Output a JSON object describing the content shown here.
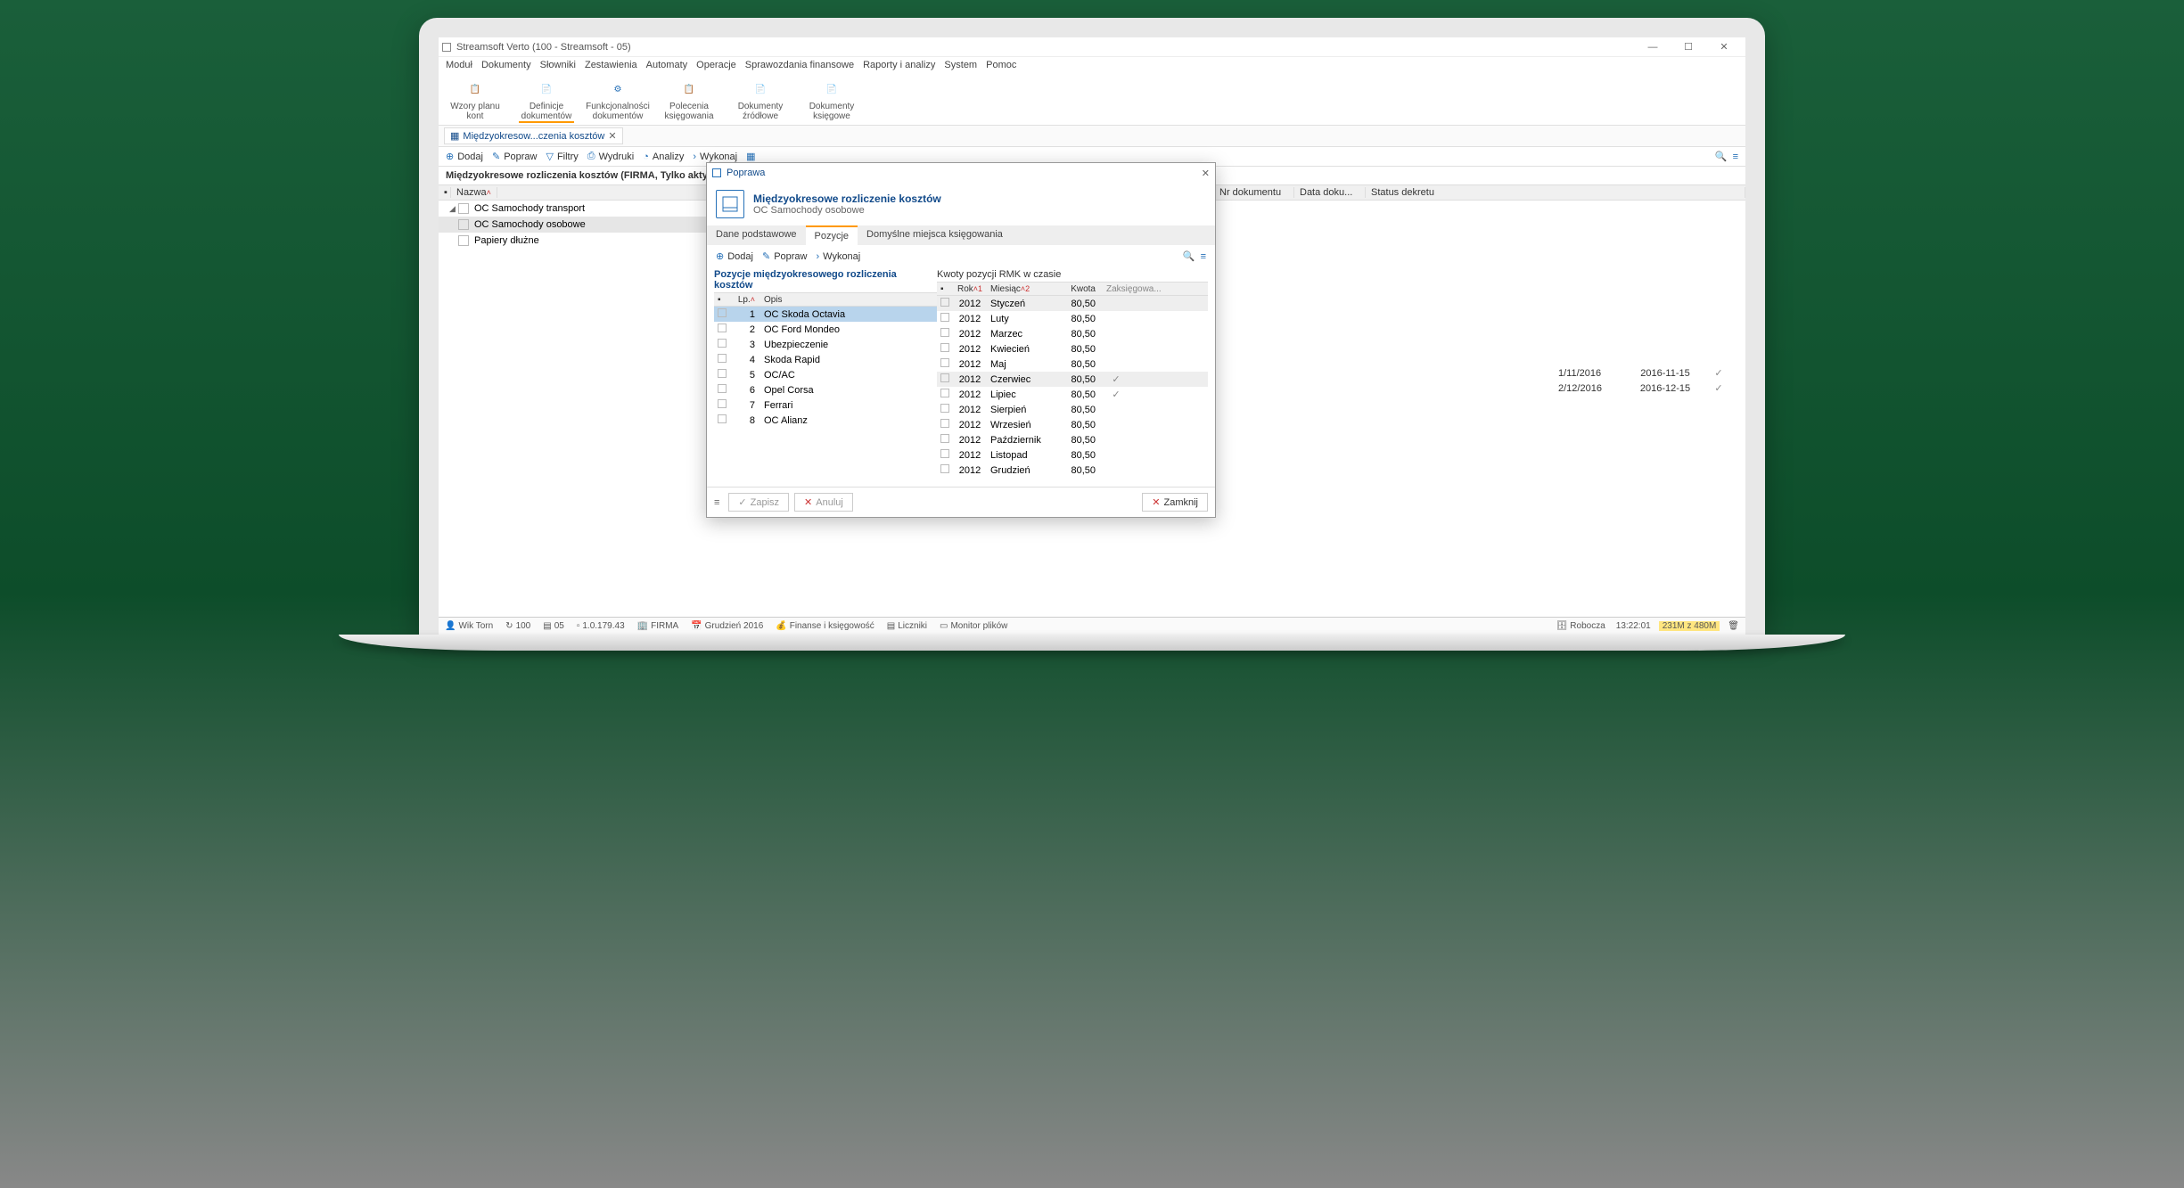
{
  "title": "Streamsoft Verto (100 - Streamsoft - 05)",
  "menu": [
    "Moduł",
    "Dokumenty",
    "Słowniki",
    "Zestawienia",
    "Automaty",
    "Operacje",
    "Sprawozdania finansowe",
    "Raporty i analizy",
    "System",
    "Pomoc"
  ],
  "ribbon": [
    {
      "l1": "Wzory planu",
      "l2": "kont"
    },
    {
      "l1": "Definicje",
      "l2": "dokumentów"
    },
    {
      "l1": "Funkcjonalności",
      "l2": "dokumentów"
    },
    {
      "l1": "Polecenia",
      "l2": "księgowania"
    },
    {
      "l1": "Dokumenty",
      "l2": "źródłowe"
    },
    {
      "l1": "Dokumenty",
      "l2": "księgowe"
    }
  ],
  "doc_tab": "Międzyokresow...czenia kosztów",
  "toolbar": [
    "Dodaj",
    "Popraw",
    "Filtry",
    "Wydruki",
    "Analizy",
    "Wykonaj"
  ],
  "section_title": "Międzyokresowe rozliczenia kosztów (FIRMA, Tylko aktywne)",
  "tree_header": "Nazwa",
  "tree": [
    {
      "label": "OC Samochody transport",
      "expanded": true
    },
    {
      "label": "OC Samochody osobowe",
      "selected": true
    },
    {
      "label": "Papiery dłużne"
    }
  ],
  "main_cols": [
    "Nr dokumentu",
    "Data doku...",
    "Status dekretu"
  ],
  "main_rows": [
    {
      "nr": "1/11/2016",
      "data": "2016-11-15"
    },
    {
      "nr": "2/12/2016",
      "data": "2016-12-15"
    }
  ],
  "dialog": {
    "title": "Poprawa",
    "header_title": "Międzyokresowe rozliczenie kosztów",
    "header_sub": "OC Samochody osobowe",
    "tabs": [
      "Dane podstawowe",
      "Pozycje",
      "Domyślne miejsca księgowania"
    ],
    "active_tab": 1,
    "tb": [
      "Dodaj",
      "Popraw",
      "Wykonaj"
    ],
    "left_title": "Pozycje międzyokresowego rozliczenia kosztów",
    "left_cols": {
      "lp": "Lp.",
      "opis": "Opis"
    },
    "left_rows": [
      {
        "lp": 1,
        "opis": "OC Skoda Octavia",
        "sel": true
      },
      {
        "lp": 2,
        "opis": "OC Ford Mondeo"
      },
      {
        "lp": 3,
        "opis": "Ubezpieczenie"
      },
      {
        "lp": 4,
        "opis": "Skoda Rapid"
      },
      {
        "lp": 5,
        "opis": "OC/AC"
      },
      {
        "lp": 6,
        "opis": "Opel Corsa"
      },
      {
        "lp": 7,
        "opis": "Ferrari"
      },
      {
        "lp": 8,
        "opis": "OC Alianz"
      }
    ],
    "right_title": "Kwoty pozycji RMK w czasie",
    "right_cols": {
      "rok": "Rok",
      "mies": "Miesiąc",
      "kwota": "Kwota",
      "zaks": "Zaksięgowa..."
    },
    "right_rows": [
      {
        "rok": 2012,
        "mies": "Styczeń",
        "kwota": "80,50",
        "hl": true
      },
      {
        "rok": 2012,
        "mies": "Luty",
        "kwota": "80,50"
      },
      {
        "rok": 2012,
        "mies": "Marzec",
        "kwota": "80,50"
      },
      {
        "rok": 2012,
        "mies": "Kwiecień",
        "kwota": "80,50"
      },
      {
        "rok": 2012,
        "mies": "Maj",
        "kwota": "80,50"
      },
      {
        "rok": 2012,
        "mies": "Czerwiec",
        "kwota": "80,50",
        "hl": true,
        "zaks": true
      },
      {
        "rok": 2012,
        "mies": "Lipiec",
        "kwota": "80,50",
        "zaks": true
      },
      {
        "rok": 2012,
        "mies": "Sierpień",
        "kwota": "80,50"
      },
      {
        "rok": 2012,
        "mies": "Wrzesień",
        "kwota": "80,50"
      },
      {
        "rok": 2012,
        "mies": "Październik",
        "kwota": "80,50"
      },
      {
        "rok": 2012,
        "mies": "Listopad",
        "kwota": "80,50"
      },
      {
        "rok": 2012,
        "mies": "Grudzień",
        "kwota": "80,50"
      }
    ],
    "footer": {
      "zapisz": "Zapisz",
      "anuluj": "Anuluj",
      "zamknij": "Zamknij"
    }
  },
  "status": {
    "user": "Wik Torn",
    "n1": "100",
    "n2": "05",
    "ver": "1.0.179.43",
    "firma": "FIRMA",
    "okres": "Grudzień 2016",
    "modul": "Finanse i księgowość",
    "liczniki": "Liczniki",
    "monitor": "Monitor plików",
    "db": "Robocza",
    "time": "13:22:01",
    "mem": "231M z 480M"
  }
}
